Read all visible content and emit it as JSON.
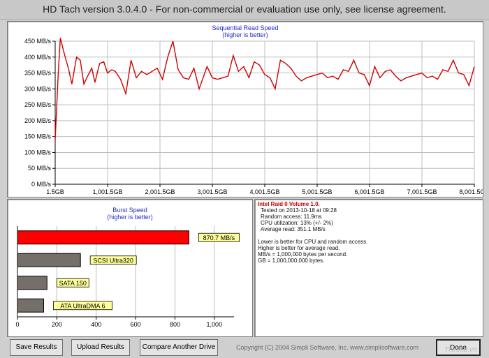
{
  "window": {
    "title": "HD Tach version 3.0.4.0  - For non-commercial or evaluation use only, see license agreement."
  },
  "seq_chart": {
    "title": "Sequential Read Speed",
    "subtitle": "(higher is better)"
  },
  "burst_chart": {
    "title": "Burst Speed",
    "subtitle": "(higher is better)"
  },
  "info": {
    "drive": "Intel Raid 0 Volume 1.0.",
    "tested": "Tested on 2013-10-18 at 09:28",
    "random": "Random access: 11.9ms",
    "cpu": "CPU utilization: 13% (+/- 2%)",
    "avg": "Average read: 351.1 MB/s",
    "note1": "Lower is better for CPU and random access.",
    "note2": "Higher is better for average read.",
    "note3": "MB/s = 1,000,000 bytes per second.",
    "note4": "GB = 1,000,000,000 bytes."
  },
  "buttons": {
    "save": "Save Results",
    "upload": "Upload Results",
    "compare": "Compare Another Drive",
    "done": "Done"
  },
  "copyright": "Copyright (C) 2004 Simpli Software, Inc. www.simplisoftware.com",
  "watermark": "Thinhte.vn",
  "colors": {
    "line": "#d00000",
    "grid": "#bdbdbd",
    "bar_gray": "#756f6a",
    "bar_red": "#ff0000",
    "label_bg": "#ffff99",
    "title_blue": "#1f29c8"
  },
  "chart_data": [
    {
      "type": "line",
      "title": "Sequential Read Speed",
      "subtitle": "(higher is better)",
      "x_ticks": [
        "1.5GB",
        "1,001.5GB",
        "2,001.5GB",
        "3,001.5GB",
        "4,001.5GB",
        "5,001.5GB",
        "6,001.5GB",
        "7,001.5GB",
        "8,001.5GB"
      ],
      "y_ticks": [
        "0 MB/s",
        "50 MB/s",
        "100 MB/s",
        "150 MB/s",
        "200 MB/s",
        "250 MB/s",
        "300 MB/s",
        "350 MB/s",
        "400 MB/s",
        "450 MB/s"
      ],
      "xlim": [
        1.5,
        8001.5
      ],
      "ylim": [
        0,
        450
      ],
      "grid": true,
      "series": [
        {
          "x": [
            1.5,
            60,
            100,
            160,
            260,
            320,
            410,
            480,
            550,
            620,
            700,
            760,
            850,
            930,
            1000,
            1080,
            1150,
            1250,
            1350,
            1450,
            1550,
            1650,
            1750,
            1850,
            1950,
            2050,
            2150,
            2250,
            2350,
            2450,
            2550,
            2650,
            2750,
            2900,
            3000,
            3100,
            3200,
            3300,
            3400,
            3500,
            3600,
            3700,
            3800,
            3900,
            4000,
            4100,
            4200,
            4300,
            4400,
            4500,
            4600,
            4700,
            4800,
            4900,
            5000,
            5100,
            5200,
            5300,
            5400,
            5500,
            5600,
            5700,
            5800,
            5900,
            6000,
            6100,
            6200,
            6300,
            6400,
            6500,
            6600,
            6700,
            6800,
            6900,
            7000,
            7100,
            7200,
            7300,
            7400,
            7500,
            7600,
            7700,
            7800,
            7900,
            8001.5
          ],
          "y": [
            140,
            350,
            460,
            420,
            360,
            315,
            400,
            390,
            315,
            340,
            365,
            320,
            380,
            385,
            350,
            360,
            355,
            330,
            285,
            390,
            335,
            355,
            345,
            355,
            365,
            330,
            400,
            450,
            360,
            335,
            330,
            365,
            300,
            370,
            335,
            330,
            335,
            340,
            405,
            355,
            370,
            335,
            385,
            375,
            345,
            335,
            300,
            390,
            380,
            365,
            340,
            325,
            335,
            340,
            345,
            350,
            335,
            340,
            330,
            360,
            355,
            390,
            350,
            345,
            310,
            370,
            335,
            355,
            360,
            340,
            325,
            335,
            340,
            345,
            350,
            335,
            340,
            330,
            360,
            355,
            390,
            350,
            345,
            310,
            370
          ]
        }
      ]
    },
    {
      "type": "bar",
      "title": "Burst Speed",
      "subtitle": "(higher is better)",
      "orientation": "horizontal",
      "x_ticks": [
        "0",
        "200",
        "400",
        "600",
        "800",
        "1,000"
      ],
      "xlim": [
        0,
        1100
      ],
      "grid": true,
      "categories": [
        "870.7 MB/s",
        "SCSI Ultra320",
        "SATA 150",
        "ATA UltraDMA 6"
      ],
      "values": [
        870.7,
        320,
        150,
        133
      ],
      "colors": [
        "#ff0000",
        "#756f6a",
        "#756f6a",
        "#756f6a"
      ]
    }
  ]
}
